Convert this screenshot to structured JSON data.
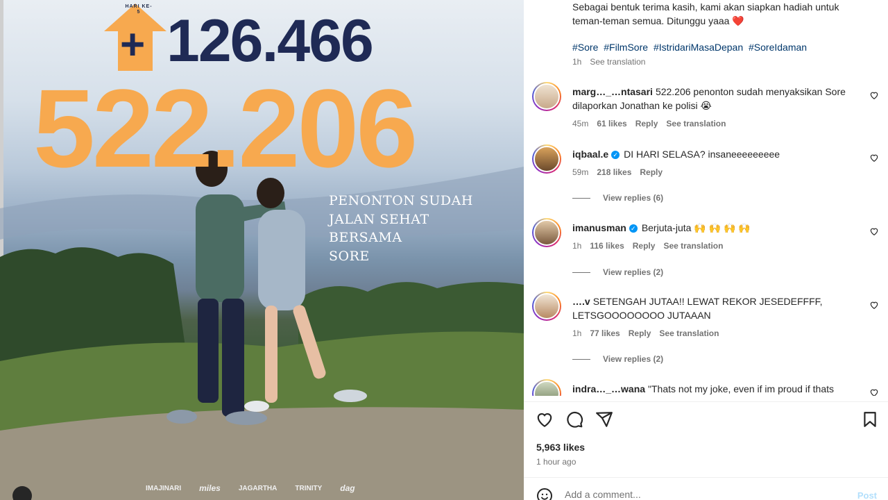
{
  "poster": {
    "day_label": "HARI KE-5",
    "plus_sign": "+",
    "day_count": "126.466",
    "total_count": "522.206",
    "tagline_lines": [
      "PENONTON SUDAH",
      "JALAN SEHAT",
      "BERSAMA",
      "SORE"
    ],
    "sponsors": [
      "IMAJINARI",
      "miles",
      "JAGARTHA",
      "TRINITY",
      "dag"
    ],
    "accent_color": "#f7a94f",
    "navy_color": "#1f2a55"
  },
  "caption": {
    "text": "Sebagai bentuk terima kasih, kami akan siapkan hadiah untuk teman-teman semua. Ditunggu yaaa ❤️",
    "hashtags": [
      "#Sore",
      "#FilmSore",
      "#IstridariMasaDepan",
      "#SoreIdaman"
    ],
    "time": "1h",
    "see_translation": "See translation"
  },
  "comments": [
    {
      "user": "marg…_…ntasari",
      "text": "522.206 penonton sudah menyaksikan Sore dilaporkan Jonathan ke polisi 😭",
      "time": "45m",
      "likes": "61 likes",
      "reply": "Reply",
      "see_translation": "See translation"
    },
    {
      "user": "iqbaal.e",
      "verified": true,
      "text": "DI HARI SELASA? insaneeeeeeeee",
      "time": "59m",
      "likes": "218 likes",
      "reply": "Reply",
      "view_replies": "View replies (6)"
    },
    {
      "user": "imanusman",
      "verified": true,
      "text": "Berjuta-juta 🙌 🙌 🙌 🙌",
      "time": "1h",
      "likes": "116 likes",
      "reply": "Reply",
      "see_translation": "See translation",
      "view_replies": "View replies (2)"
    },
    {
      "user": "….v",
      "text": "SETENGAH JUTAA!! LEWAT REKOR JESEDEFFFF, LETSGOOOOOOOO JUTAAAN",
      "time": "1h",
      "likes": "77 likes",
      "reply": "Reply",
      "see_translation": "See translation",
      "view_replies": "View replies (2)"
    },
    {
      "user": "indra…_…wana",
      "text": "\"Thats not my joke, even if im proud if thats",
      "time": "",
      "likes": "",
      "reply": ""
    }
  ],
  "post": {
    "likes": "5,963 likes",
    "time_ago": "1 hour ago",
    "add_comment_placeholder": "Add a comment...",
    "post_label": "Post"
  },
  "colors": {
    "link": "#00376b",
    "muted": "#737373",
    "verified": "#0095f6"
  }
}
